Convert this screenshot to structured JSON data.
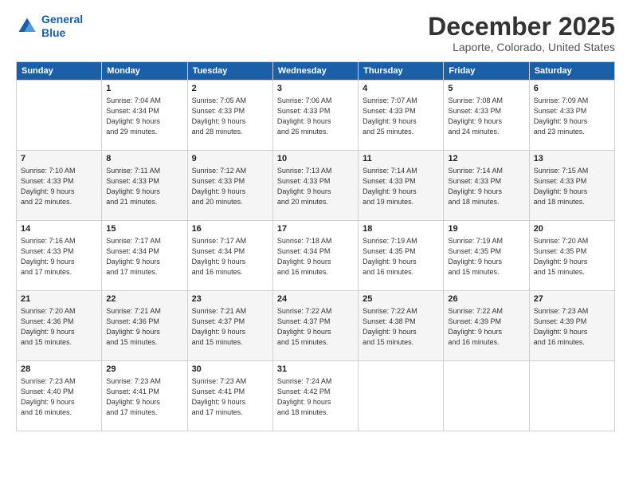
{
  "logo": {
    "line1": "General",
    "line2": "Blue"
  },
  "title": "December 2025",
  "subtitle": "Laporte, Colorado, United States",
  "days_of_week": [
    "Sunday",
    "Monday",
    "Tuesday",
    "Wednesday",
    "Thursday",
    "Friday",
    "Saturday"
  ],
  "weeks": [
    [
      {
        "day": "",
        "sunrise": "",
        "sunset": "",
        "daylight": ""
      },
      {
        "day": "1",
        "sunrise": "Sunrise: 7:04 AM",
        "sunset": "Sunset: 4:34 PM",
        "daylight": "Daylight: 9 hours and 29 minutes."
      },
      {
        "day": "2",
        "sunrise": "Sunrise: 7:05 AM",
        "sunset": "Sunset: 4:33 PM",
        "daylight": "Daylight: 9 hours and 28 minutes."
      },
      {
        "day": "3",
        "sunrise": "Sunrise: 7:06 AM",
        "sunset": "Sunset: 4:33 PM",
        "daylight": "Daylight: 9 hours and 26 minutes."
      },
      {
        "day": "4",
        "sunrise": "Sunrise: 7:07 AM",
        "sunset": "Sunset: 4:33 PM",
        "daylight": "Daylight: 9 hours and 25 minutes."
      },
      {
        "day": "5",
        "sunrise": "Sunrise: 7:08 AM",
        "sunset": "Sunset: 4:33 PM",
        "daylight": "Daylight: 9 hours and 24 minutes."
      },
      {
        "day": "6",
        "sunrise": "Sunrise: 7:09 AM",
        "sunset": "Sunset: 4:33 PM",
        "daylight": "Daylight: 9 hours and 23 minutes."
      }
    ],
    [
      {
        "day": "7",
        "sunrise": "Sunrise: 7:10 AM",
        "sunset": "Sunset: 4:33 PM",
        "daylight": "Daylight: 9 hours and 22 minutes."
      },
      {
        "day": "8",
        "sunrise": "Sunrise: 7:11 AM",
        "sunset": "Sunset: 4:33 PM",
        "daylight": "Daylight: 9 hours and 21 minutes."
      },
      {
        "day": "9",
        "sunrise": "Sunrise: 7:12 AM",
        "sunset": "Sunset: 4:33 PM",
        "daylight": "Daylight: 9 hours and 20 minutes."
      },
      {
        "day": "10",
        "sunrise": "Sunrise: 7:13 AM",
        "sunset": "Sunset: 4:33 PM",
        "daylight": "Daylight: 9 hours and 20 minutes."
      },
      {
        "day": "11",
        "sunrise": "Sunrise: 7:14 AM",
        "sunset": "Sunset: 4:33 PM",
        "daylight": "Daylight: 9 hours and 19 minutes."
      },
      {
        "day": "12",
        "sunrise": "Sunrise: 7:14 AM",
        "sunset": "Sunset: 4:33 PM",
        "daylight": "Daylight: 9 hours and 18 minutes."
      },
      {
        "day": "13",
        "sunrise": "Sunrise: 7:15 AM",
        "sunset": "Sunset: 4:33 PM",
        "daylight": "Daylight: 9 hours and 18 minutes."
      }
    ],
    [
      {
        "day": "14",
        "sunrise": "Sunrise: 7:16 AM",
        "sunset": "Sunset: 4:33 PM",
        "daylight": "Daylight: 9 hours and 17 minutes."
      },
      {
        "day": "15",
        "sunrise": "Sunrise: 7:17 AM",
        "sunset": "Sunset: 4:34 PM",
        "daylight": "Daylight: 9 hours and 17 minutes."
      },
      {
        "day": "16",
        "sunrise": "Sunrise: 7:17 AM",
        "sunset": "Sunset: 4:34 PM",
        "daylight": "Daylight: 9 hours and 16 minutes."
      },
      {
        "day": "17",
        "sunrise": "Sunrise: 7:18 AM",
        "sunset": "Sunset: 4:34 PM",
        "daylight": "Daylight: 9 hours and 16 minutes."
      },
      {
        "day": "18",
        "sunrise": "Sunrise: 7:19 AM",
        "sunset": "Sunset: 4:35 PM",
        "daylight": "Daylight: 9 hours and 16 minutes."
      },
      {
        "day": "19",
        "sunrise": "Sunrise: 7:19 AM",
        "sunset": "Sunset: 4:35 PM",
        "daylight": "Daylight: 9 hours and 15 minutes."
      },
      {
        "day": "20",
        "sunrise": "Sunrise: 7:20 AM",
        "sunset": "Sunset: 4:35 PM",
        "daylight": "Daylight: 9 hours and 15 minutes."
      }
    ],
    [
      {
        "day": "21",
        "sunrise": "Sunrise: 7:20 AM",
        "sunset": "Sunset: 4:36 PM",
        "daylight": "Daylight: 9 hours and 15 minutes."
      },
      {
        "day": "22",
        "sunrise": "Sunrise: 7:21 AM",
        "sunset": "Sunset: 4:36 PM",
        "daylight": "Daylight: 9 hours and 15 minutes."
      },
      {
        "day": "23",
        "sunrise": "Sunrise: 7:21 AM",
        "sunset": "Sunset: 4:37 PM",
        "daylight": "Daylight: 9 hours and 15 minutes."
      },
      {
        "day": "24",
        "sunrise": "Sunrise: 7:22 AM",
        "sunset": "Sunset: 4:37 PM",
        "daylight": "Daylight: 9 hours and 15 minutes."
      },
      {
        "day": "25",
        "sunrise": "Sunrise: 7:22 AM",
        "sunset": "Sunset: 4:38 PM",
        "daylight": "Daylight: 9 hours and 15 minutes."
      },
      {
        "day": "26",
        "sunrise": "Sunrise: 7:22 AM",
        "sunset": "Sunset: 4:39 PM",
        "daylight": "Daylight: 9 hours and 16 minutes."
      },
      {
        "day": "27",
        "sunrise": "Sunrise: 7:23 AM",
        "sunset": "Sunset: 4:39 PM",
        "daylight": "Daylight: 9 hours and 16 minutes."
      }
    ],
    [
      {
        "day": "28",
        "sunrise": "Sunrise: 7:23 AM",
        "sunset": "Sunset: 4:40 PM",
        "daylight": "Daylight: 9 hours and 16 minutes."
      },
      {
        "day": "29",
        "sunrise": "Sunrise: 7:23 AM",
        "sunset": "Sunset: 4:41 PM",
        "daylight": "Daylight: 9 hours and 17 minutes."
      },
      {
        "day": "30",
        "sunrise": "Sunrise: 7:23 AM",
        "sunset": "Sunset: 4:41 PM",
        "daylight": "Daylight: 9 hours and 17 minutes."
      },
      {
        "day": "31",
        "sunrise": "Sunrise: 7:24 AM",
        "sunset": "Sunset: 4:42 PM",
        "daylight": "Daylight: 9 hours and 18 minutes."
      },
      {
        "day": "",
        "sunrise": "",
        "sunset": "",
        "daylight": ""
      },
      {
        "day": "",
        "sunrise": "",
        "sunset": "",
        "daylight": ""
      },
      {
        "day": "",
        "sunrise": "",
        "sunset": "",
        "daylight": ""
      }
    ]
  ]
}
